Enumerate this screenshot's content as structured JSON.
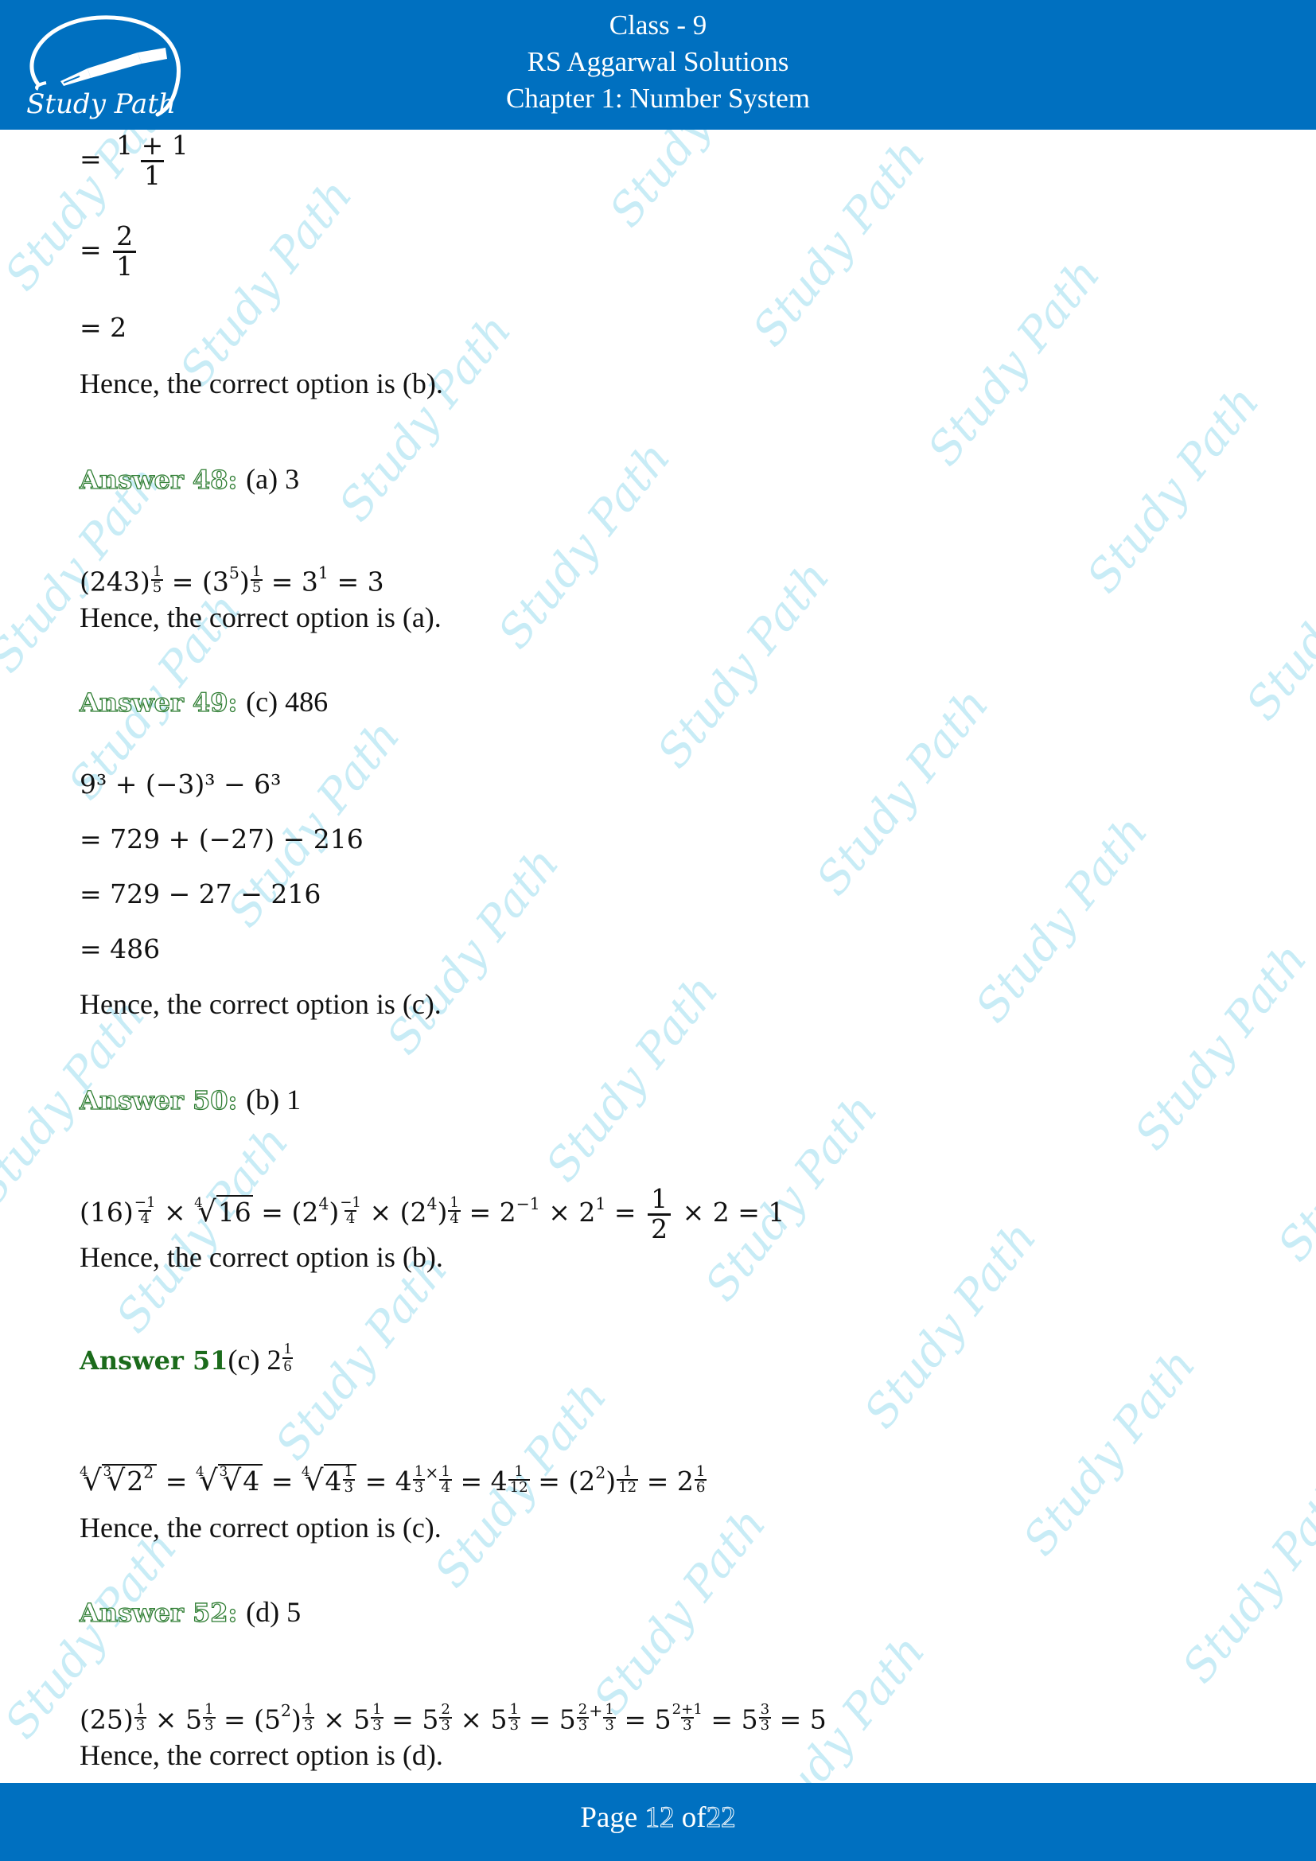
{
  "header": {
    "logo_text": "Study Path",
    "line1": "Class - 9",
    "line2": "RS Aggarwal Solutions",
    "line3": "Chapter 1: Number System"
  },
  "footer": {
    "prefix": "Page",
    "current": "12",
    "separator": "of",
    "total": "22"
  },
  "watermark": "Study Path",
  "colors": {
    "brand_blue": "#0070c0",
    "answer_green": "#2e7d32",
    "watermark": "#c8ecf6"
  },
  "continuation": {
    "step1": {
      "eq": "=",
      "num": "1 + 1",
      "den": "1"
    },
    "step2": {
      "eq": "=",
      "num": "2",
      "den": "1"
    },
    "step3": "= 2",
    "conclusion": "Hence, the correct option is (b)."
  },
  "answers": [
    {
      "label": "Answer 48:",
      "value": "(a) 3",
      "work": "(243)^(1/5) = (3^5)^(1/5) = 3^1 = 3",
      "conclusion": "Hence, the correct option is (a)."
    },
    {
      "label": "Answer 49:",
      "value": "(c) 486",
      "steps": [
        "9³ + (−3)³ − 6³",
        "= 729 + (−27) − 216",
        "= 729 − 27 − 216",
        "= 486"
      ],
      "conclusion": "Hence, the correct option is (c)."
    },
    {
      "label": "Answer 50:",
      "value": "(b) 1",
      "work": "(16)^(−1/4) × ⁴√16 = (2^4)^(−1/4) × (2^4)^(1/4) = 2^−1 × 2^1 = 1/2 × 2 = 1",
      "conclusion": "Hence, the correct option is (b)."
    },
    {
      "label": "Answer 51",
      "value": ": (c) 2^(1/6)",
      "work": "⁴√(³√(2²)) = ⁴√(³√4) = ⁴√(4^(1/3)) = 4^(1/3 × 1/4) = 4^(1/12) = (2²)^(1/12) = 2^(1/6)",
      "conclusion": "Hence, the correct option is (c)."
    },
    {
      "label": "Answer 52:",
      "value": "(d) 5",
      "work": "(25)^(1/3) × 5^(1/3) = (5²)^(1/3) × 5^(1/3) = 5^(2/3) × 5^(1/3) = 5^(2/3+1/3) = 5^((2+1)/3) = 5^(3/3) = 5",
      "conclusion": "Hence, the correct option is (d)."
    }
  ],
  "glyphs": {
    "eq": "=",
    "times": "×",
    "plus": "+",
    "minus": "−",
    "one": "1",
    "two": "2",
    "three": "3",
    "four": "4",
    "five": "5",
    "six": "6",
    "twelve": "12",
    "neg": "−",
    "radical": "√",
    "lp": "(",
    "rp": ")",
    "b16": "(16)",
    "r16": "16",
    "b243": "(243)",
    "b25": "(25)",
    "two_plus_one": "2+1",
    "label_a": "(a) 3",
    "label_c": "(c) ",
    "val_b1": "(b) 1"
  }
}
